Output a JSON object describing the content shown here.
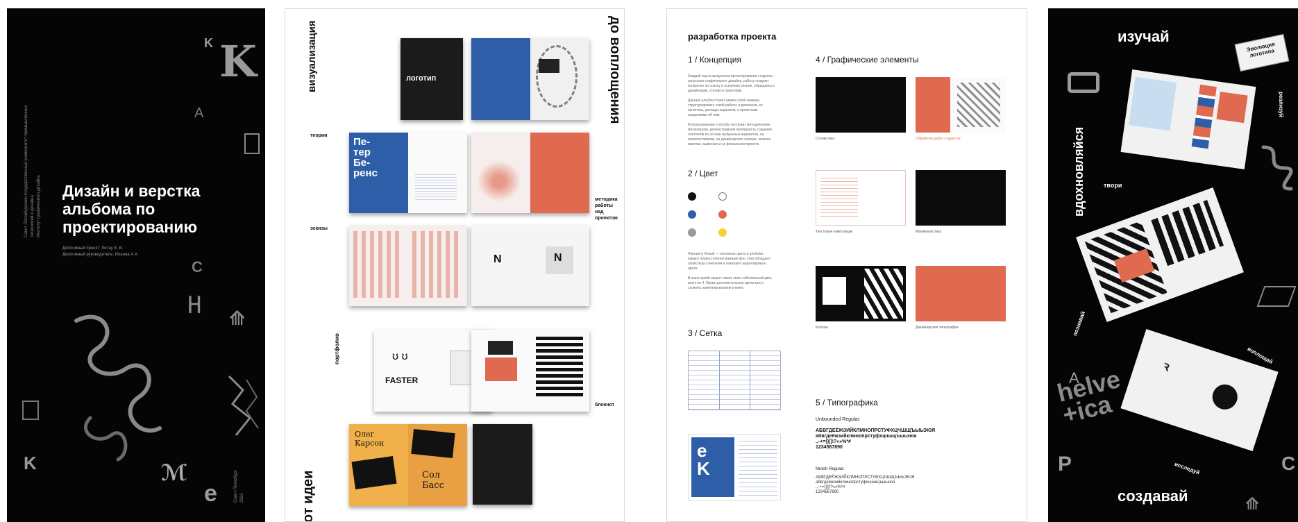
{
  "panel1": {
    "title": "Дизайн и верстка альбома по проектированию",
    "subtitle": "Дипломный проект: Литау Е. В.\nДипломный руководитель: Ильина А.А.",
    "vertical": "Санкт-Петербургский государственный университет промышленных технологий и дизайна\nИнститут графического дизайна",
    "city": "Санкт-Петербург\n2023"
  },
  "panel2": {
    "left_top": "визуализация",
    "right_top": "до воплощения",
    "left_bottom": "от идеи",
    "book_label": "логотип",
    "poster_text": "Пе-\nтер\nБе-\nренс",
    "labels": {
      "teoriya": "теории",
      "metodika": "методика\nработы\nнад\nпроектом",
      "eskizy": "эскизы",
      "portfolio": "портфолио",
      "bloknot": "блокнот",
      "faster": "FASTER"
    },
    "poster_words": {
      "w1": "Олег\nКарсон",
      "w2": "Сол\nБасс"
    }
  },
  "panel3": {
    "header": "разработка проекта",
    "s1": "1 / Концепция",
    "s2": "2 / Цвет",
    "s3": "3 / Сетка",
    "s4": "4 / Графические элементы",
    "s5": "5 / Типографика",
    "concept_text": "Каждый год на выпускном проектировании студенты запускают графического дизайна, работу создают конкретно по списку и основные знания, обращаясь к дизайнерам, стилям и практикам.\n\nДанный альбом станет неким собой важную, структурировать такой работы и дополнить ее занятием, доклада-заданием, а проектным сведениями об ним.\n\nИспользованные способы послужат методическим материалом, демонстрируем наглядность создания логотипов по основе выбранных вариантов, на комплектовании, на дизайнерских эскизах, эскизах, макетах, вывесках и на финальном проекте.",
    "color_text": "Черный и белый — основные цвета в альбоме играют первостепенно важный фон. Они обладают свойством сочетания и помогают акцентировать цвета.\n\nВ книге яркий акцент имеет свою собственный цвет, всего их 4. Яркие дополнительные цвета могут служить ориентированием в книге.",
    "font1_label": "Unbounded Regular:",
    "font1_sample": "АБВГДЕЁЖЗИЙКЛМНОПРСТУФХЦЧШЩЪЫЬЭЮЯ\nабвгдеёжзийклмнопрстуфхцчшщъыьэюя\n.,-+=()[]!?«»%*#\n1234567890",
    "font2_label": "Mulish Regular:",
    "font2_sample": "АБВГДЕЁЖЗИЙКЛМНОПРСТУФХЦЧШЩЪЫЬЭЮЯ\nабвгдеёжзийклмнопрстуфхцчшщъыьэюя\n.,-+=()[]!?«»%*#\n1234567890",
    "captions": {
      "c1": "Стилистика",
      "c2": "Обработка работ студентов",
      "c3": "Текстовые композиции",
      "c4": "Минималистика",
      "c5": "Коллаж",
      "c6": "Дизайнерские типографии"
    }
  },
  "panel4": {
    "w_top": "изучай",
    "w_left": "вдохновляйся",
    "w_bottom": "создавай",
    "w_tvori": "твори",
    "w_realizuy": "реализуй",
    "w_pozn": "познавай",
    "w_voploshay": "воплощай",
    "w_issleduy": "исследуй",
    "helvetica": "helve\n+ica",
    "sticker": "Эволюция\nлоготипа"
  },
  "colors": {
    "orange": "#e06a4f",
    "blue": "#2f5ea8",
    "yellow": "#f2d13a",
    "grey": "#9a9a9a",
    "dark": "#111111"
  }
}
